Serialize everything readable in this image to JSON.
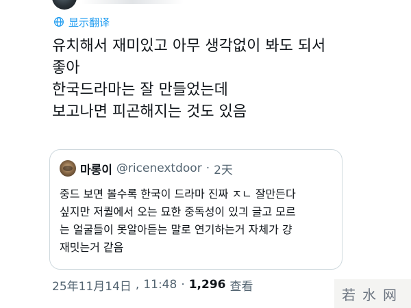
{
  "tweet": {
    "translate_label": "显示翻译",
    "lines": [
      "유치해서 재미있고 아무 생각없이 봐도 되서",
      "좋아",
      "한국드라마는 잘 만들었는데",
      "보고나면 피곤해지는 것도 있음"
    ]
  },
  "quote": {
    "display_name": "마롱이",
    "handle": "@ricenextdoor",
    "separator": "·",
    "time": "2天",
    "lines": [
      "중드 보면 볼수록 한국이 드라마 진짜 ㅈㄴ 잘만든다",
      "싶지만 저퀄에서 오는 묘한 중독성이 있긔 글고 모르",
      "는 얼굴들이 못알아듣는 말로 연기하는거 자체가 걍",
      "재밋는거 같음"
    ]
  },
  "meta": {
    "date": "25年11月14日",
    "time": "11:48",
    "separator": "·",
    "views_count": "1,296",
    "views_label": "查看"
  },
  "watermark": {
    "text": "若水网"
  },
  "colors": {
    "accent": "#1d9bf0",
    "text_primary": "#0f1419",
    "text_secondary": "#536471",
    "border": "#cfd9de"
  },
  "icons": {
    "translate": "globe-icon"
  }
}
